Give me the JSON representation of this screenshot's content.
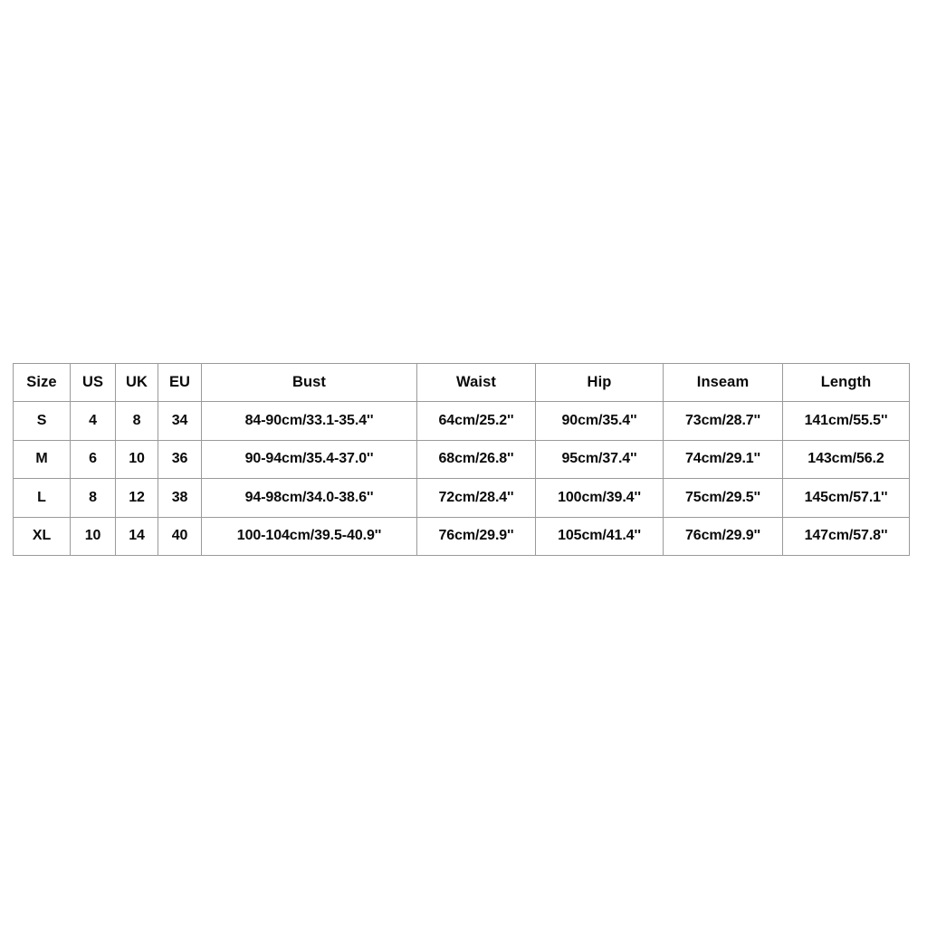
{
  "document": {
    "type": "size-chart-table",
    "background_color": "#ffffff",
    "text_color": "#0a0a0a",
    "border_color": "#9a9a9a"
  },
  "table": {
    "columns": [
      {
        "key": "size",
        "label": "Size"
      },
      {
        "key": "us",
        "label": "US"
      },
      {
        "key": "uk",
        "label": "UK"
      },
      {
        "key": "eu",
        "label": "EU"
      },
      {
        "key": "bust",
        "label": "Bust"
      },
      {
        "key": "waist",
        "label": "Waist"
      },
      {
        "key": "hip",
        "label": "Hip"
      },
      {
        "key": "inseam",
        "label": "Inseam"
      },
      {
        "key": "length",
        "label": "Length"
      }
    ],
    "rows": [
      {
        "size": "S",
        "us": "4",
        "uk": "8",
        "eu": "34",
        "bust": "84-90cm/33.1-35.4''",
        "waist": "64cm/25.2''",
        "hip": "90cm/35.4''",
        "inseam": "73cm/28.7''",
        "length": "141cm/55.5''"
      },
      {
        "size": "M",
        "us": "6",
        "uk": "10",
        "eu": "36",
        "bust": "90-94cm/35.4-37.0''",
        "waist": "68cm/26.8''",
        "hip": "95cm/37.4''",
        "inseam": "74cm/29.1''",
        "length": "143cm/56.2"
      },
      {
        "size": "L",
        "us": "8",
        "uk": "12",
        "eu": "38",
        "bust": "94-98cm/34.0-38.6''",
        "waist": "72cm/28.4''",
        "hip": "100cm/39.4''",
        "inseam": "75cm/29.5''",
        "length": "145cm/57.1''"
      },
      {
        "size": "XL",
        "us": "10",
        "uk": "14",
        "eu": "40",
        "bust": "100-104cm/39.5-40.9''",
        "waist": "76cm/29.9''",
        "hip": "105cm/41.4''",
        "inseam": "76cm/29.9''",
        "length": "147cm/57.8''"
      }
    ]
  }
}
